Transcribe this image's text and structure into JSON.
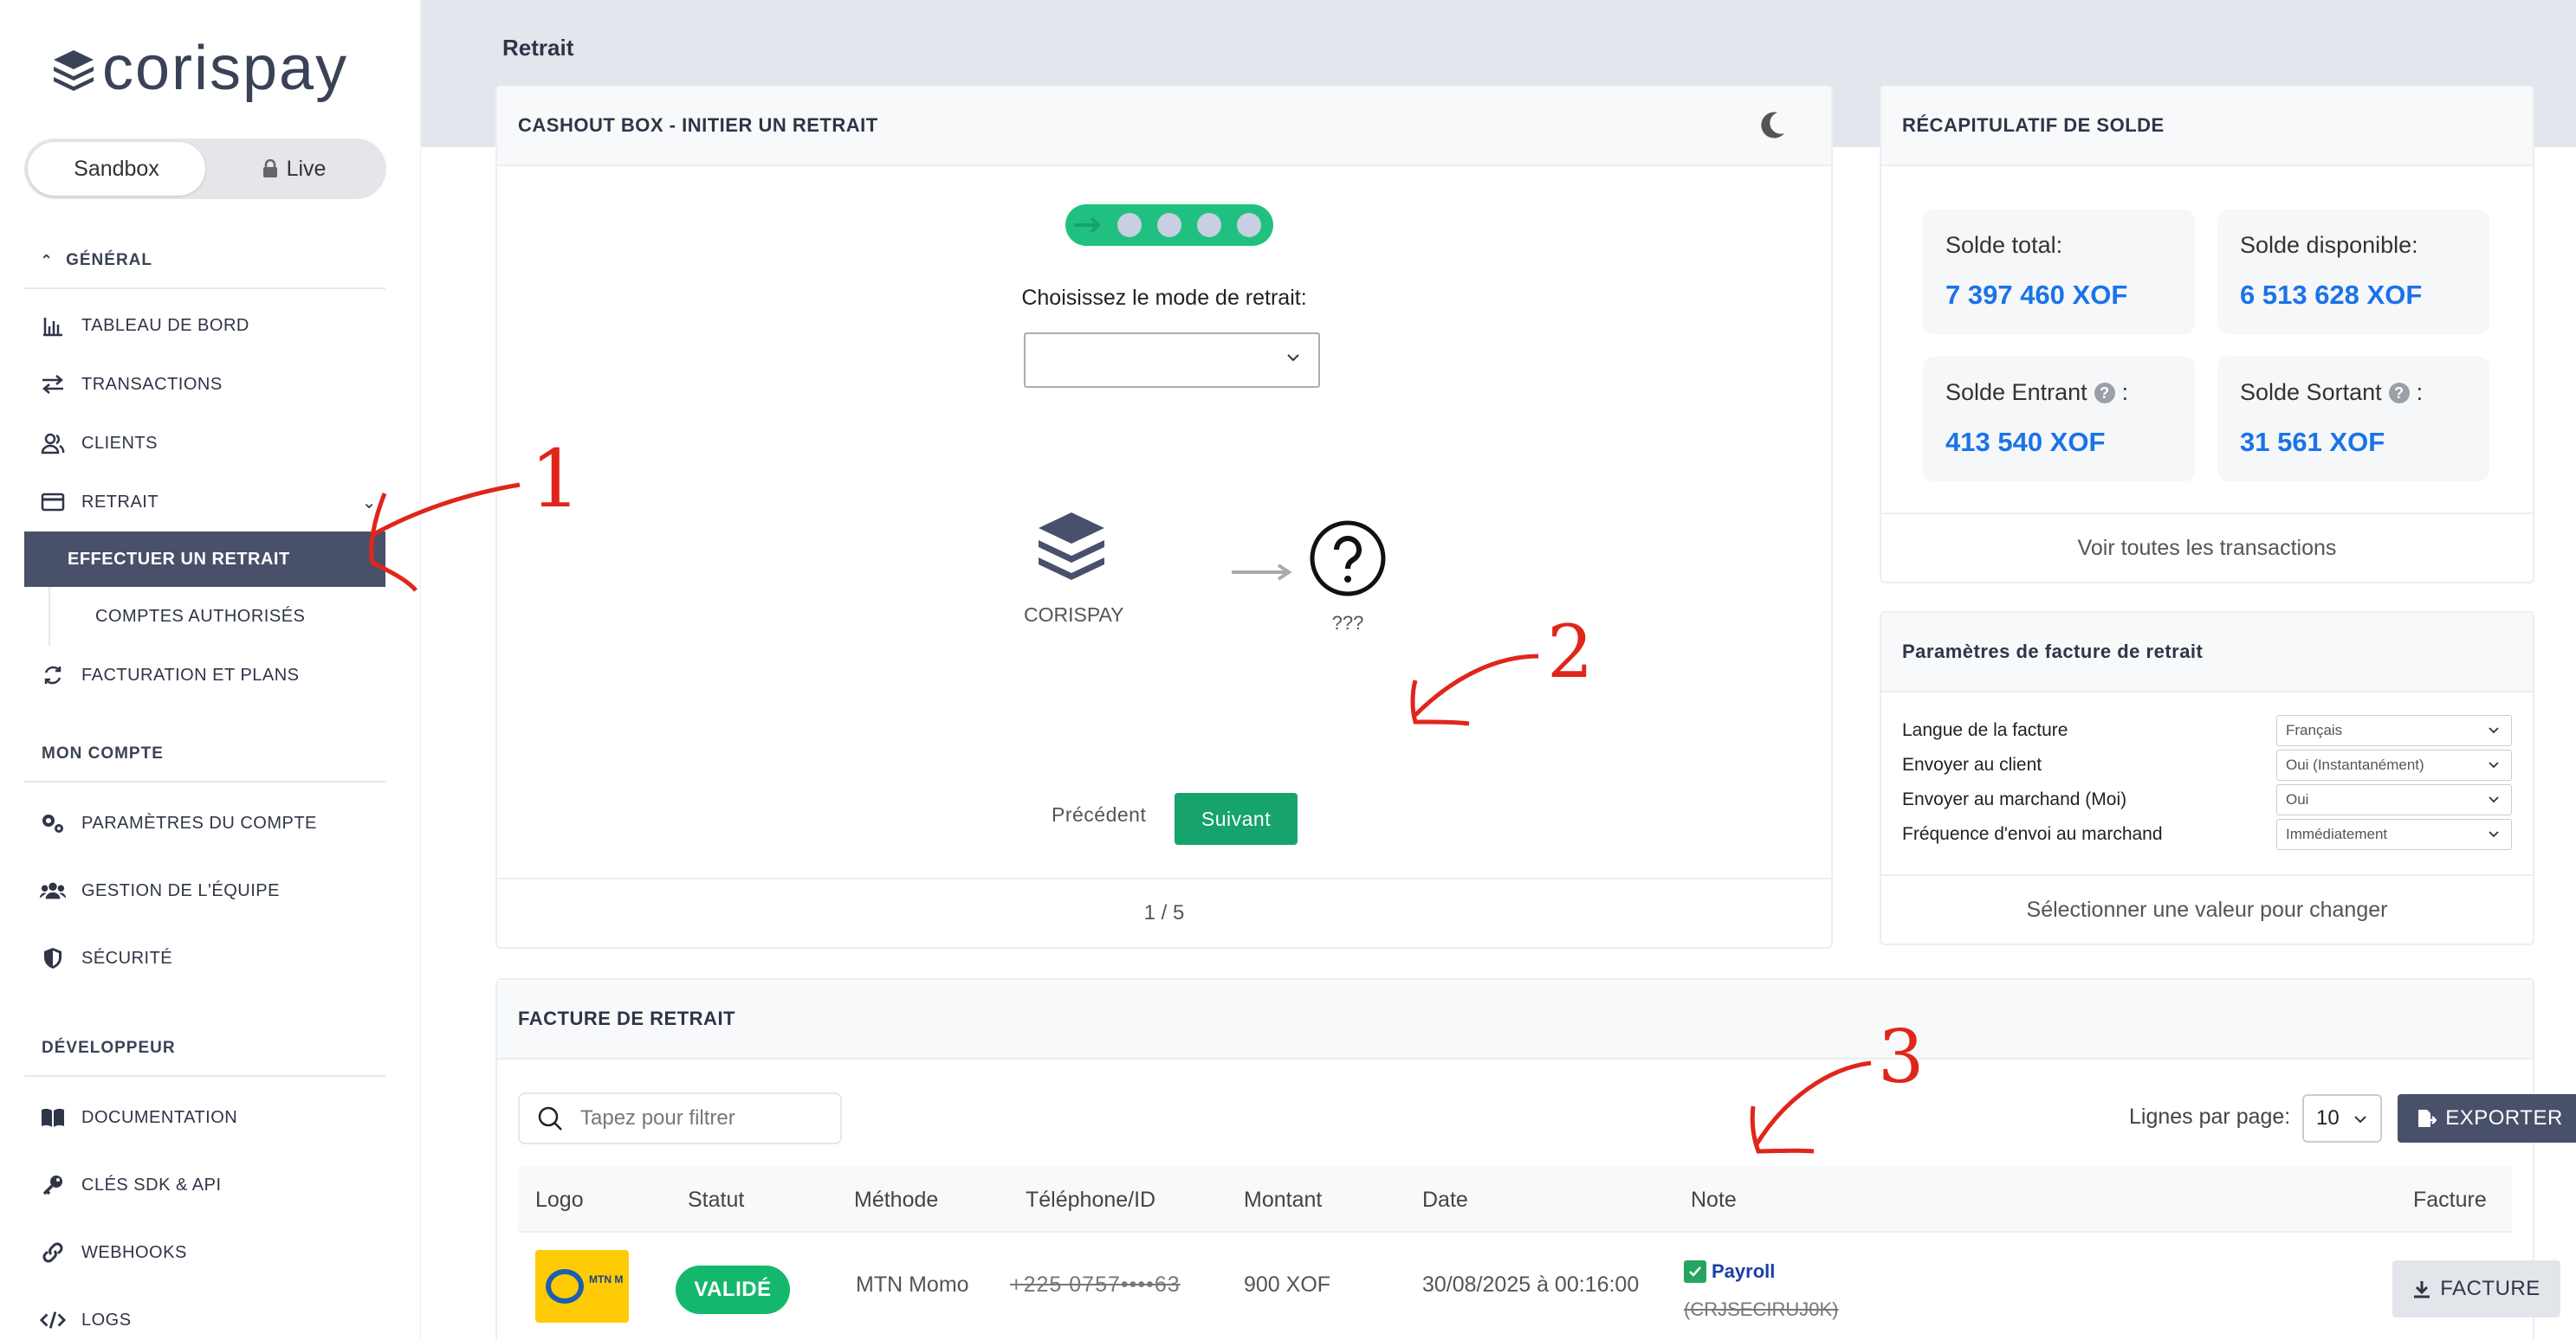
{
  "brand": {
    "name": "corispay"
  },
  "env_toggle": {
    "sandbox": "Sandbox",
    "live": "Live"
  },
  "sidebar": {
    "general_title": "GÉNÉRAL",
    "general_items": [
      {
        "label": "TABLEAU DE BORD",
        "icon": "chart-icon"
      },
      {
        "label": "TRANSACTIONS",
        "icon": "exchange-icon"
      },
      {
        "label": "CLIENTS",
        "icon": "users-icon"
      },
      {
        "label": "RETRAIT",
        "icon": "card-icon"
      }
    ],
    "retrait_sub": [
      {
        "label": "EFFECTUER UN RETRAIT",
        "active": true
      },
      {
        "label": "COMPTES AUTHORISÉS",
        "active": false
      }
    ],
    "billing": {
      "label": "FACTURATION ET PLANS",
      "icon": "refresh-icon"
    },
    "account_title": "MON COMPTE",
    "account_items": [
      {
        "label": "PARAMÈTRES DU COMPTE",
        "icon": "gears-icon"
      },
      {
        "label": "GESTION DE L'ÉQUIPE",
        "icon": "team-icon"
      },
      {
        "label": "SÉCURITÉ",
        "icon": "shield-icon"
      }
    ],
    "dev_title": "DÉVELOPPEUR",
    "dev_items": [
      {
        "label": "DOCUMENTATION",
        "icon": "book-icon"
      },
      {
        "label": "CLÉS SDK & API",
        "icon": "key-icon"
      },
      {
        "label": "WEBHOOKS",
        "icon": "link-icon"
      },
      {
        "label": "LOGS",
        "icon": "code-icon"
      }
    ]
  },
  "page": {
    "title": "Retrait"
  },
  "cashout": {
    "title": "CASHOUT BOX - INITIER UN RETRAIT",
    "step_current": 1,
    "step_total": 5,
    "mode_label": "Choisissez le mode de retrait:",
    "mode_value": "",
    "source_label": "CORISPAY",
    "dest_label": "???",
    "prev_label": "Précédent",
    "next_label": "Suivant",
    "pager": "1 / 5"
  },
  "balance": {
    "title": "RÉCAPITULATIF DE SOLDE",
    "total_label": "Solde total:",
    "total_value": "7 397 460 XOF",
    "available_label": "Solde disponible:",
    "available_value": "6 513 628 XOF",
    "in_label": "Solde Entrant",
    "in_value": "413 540 XOF",
    "out_label": "Solde Sortant",
    "out_value": "31 561 XOF",
    "colon": ":",
    "footer": "Voir toutes les transactions"
  },
  "invoice_params": {
    "title": "Paramètres de facture de retrait",
    "rows": [
      {
        "label": "Langue de la facture",
        "value": "Français"
      },
      {
        "label": "Envoyer au client",
        "value": "Oui (Instantanément)"
      },
      {
        "label": "Envoyer au marchand (Moi)",
        "value": "Oui"
      },
      {
        "label": "Fréquence d'envoi au marchand",
        "value": "Immédiatement"
      }
    ],
    "footer": "Sélectionner une valeur pour changer"
  },
  "invoices": {
    "title": "FACTURE DE RETRAIT",
    "filter_placeholder": "Tapez pour filtrer",
    "rows_label": "Lignes par page:",
    "rows_value": "10",
    "export_label": "EXPORTER",
    "columns": [
      "Logo",
      "Statut",
      "Méthode",
      "Téléphone/ID",
      "Montant",
      "Date",
      "Note",
      "Facture"
    ],
    "rows": [
      {
        "logo": "MTN MoMo",
        "status": "VALIDÉ",
        "method": "MTN Momo",
        "phone": "+225 0757••••63",
        "amount": "900 XOF",
        "date": "30/08/2025 à 00:16:00",
        "note": "Payroll",
        "note_sub": "(CRJSECIRUJ0K)",
        "invoice_label": "FACTURE"
      }
    ]
  },
  "annotations": [
    "1",
    "2",
    "3"
  ],
  "colors": {
    "accent": "#16a36c",
    "sidebar_active": "#48506a",
    "value_blue": "#1a73e8",
    "annotation_red": "#e0261b"
  }
}
